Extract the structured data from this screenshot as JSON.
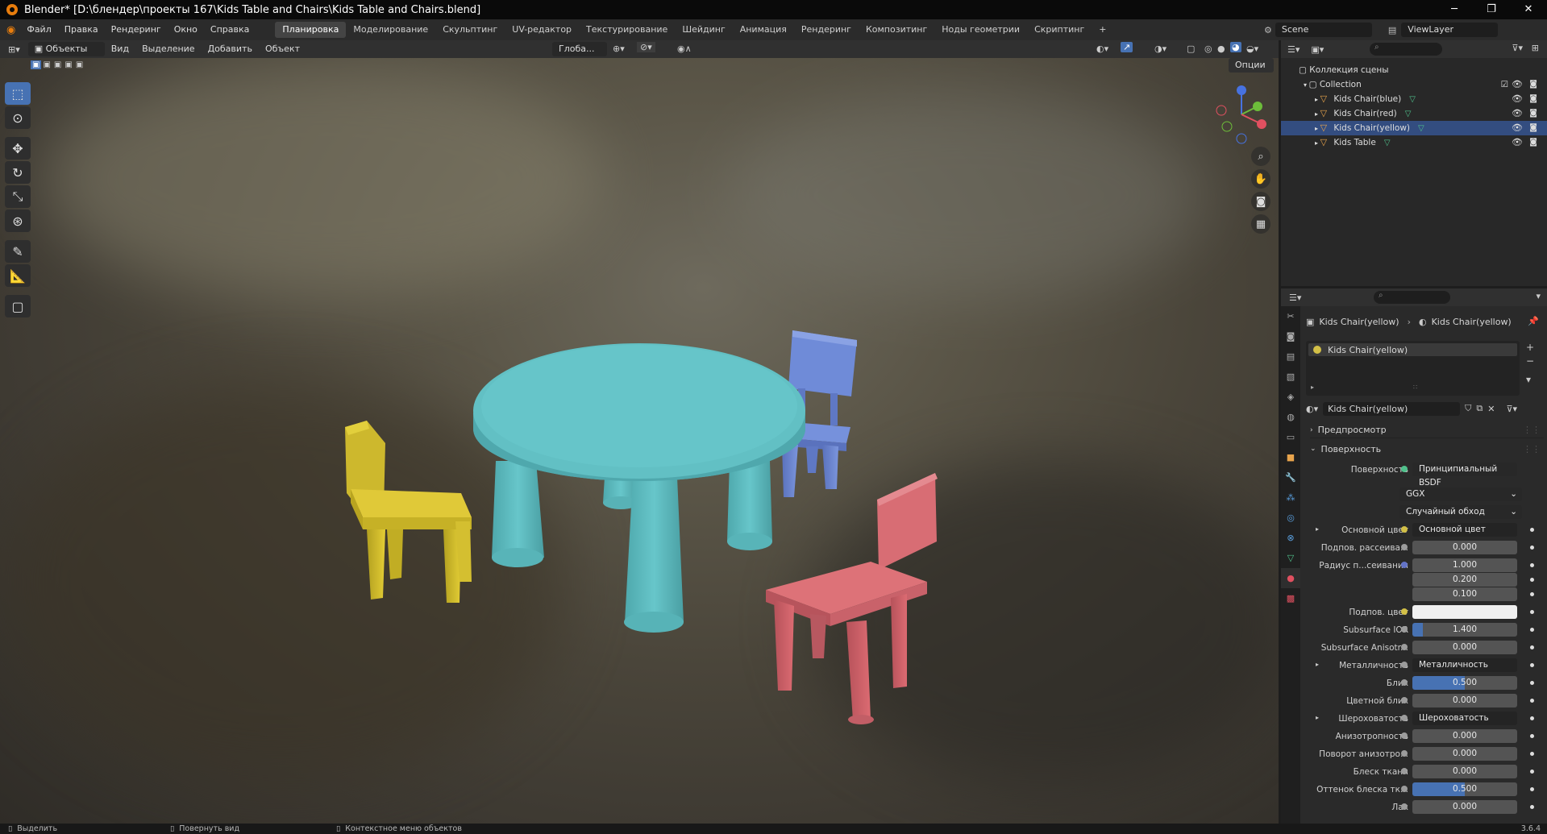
{
  "window": {
    "title": "Blender* [D:\\блендер\\проекты 167\\Kids Table and Chairs\\Kids Table and Chairs.blend]",
    "minimize": "─",
    "maximize": "❐",
    "close": "✕"
  },
  "menu": {
    "items": [
      "Файл",
      "Правка",
      "Рендеринг",
      "Окно",
      "Справка"
    ],
    "workspaces": [
      "Планировка",
      "Моделирование",
      "Скульптинг",
      "UV-редактор",
      "Текстурирование",
      "Шейдинг",
      "Анимация",
      "Рендеринг",
      "Композитинг",
      "Ноды геометрии",
      "Скриптинг"
    ],
    "add_tab": "+",
    "scene": "Scene",
    "view_layer": "ViewLayer"
  },
  "viewport_header": {
    "mode": "Объекты",
    "menus": [
      "Вид",
      "Выделение",
      "Добавить",
      "Объект"
    ],
    "orientation": "Глоба...",
    "options": "Опции"
  },
  "outliner": {
    "root": "Коллекция сцены",
    "collection": "Collection",
    "objects": [
      "Kids Chair(blue)",
      "Kids Chair(red)",
      "Kids Chair(yellow)",
      "Kids Table"
    ],
    "selected_index": 2
  },
  "properties": {
    "breadcrumb_object": "Kids Chair(yellow)",
    "breadcrumb_material": "Kids Chair(yellow)",
    "slot": "Kids Chair(yellow)",
    "material_name": "Kids Chair(yellow)",
    "panel_preview": "Предпросмотр",
    "panel_surface": "Поверхность",
    "surface_label": "Поверхность",
    "surface_value": "Принципиальный BSDF",
    "distribution": "GGX",
    "subsurface_method": "Случайный обход",
    "rows": [
      {
        "label": "Основной цвет",
        "value": "Основной цвет",
        "type": "link",
        "dot": "y",
        "expand": true
      },
      {
        "label": "Подпов. рассеива...",
        "value": "0.000",
        "type": "num",
        "dot": "g"
      },
      {
        "label": "Радиус п...сеивания",
        "value": "1.000",
        "type": "num",
        "dot": "b"
      },
      {
        "label": "",
        "value": "0.200",
        "type": "num",
        "dot": ""
      },
      {
        "label": "",
        "value": "0.100",
        "type": "num",
        "dot": ""
      },
      {
        "label": "Подпов. цвет",
        "value": "",
        "type": "color",
        "dot": "y"
      },
      {
        "label": "Subsurface IOR",
        "value": "1.400",
        "type": "fill",
        "fill": 0.1,
        "dot": "g"
      },
      {
        "label": "Subsurface Anisotr...",
        "value": "0.000",
        "type": "num",
        "dot": "g"
      },
      {
        "label": "Металличность",
        "value": "Металличность",
        "type": "link",
        "dot": "g",
        "expand": true
      },
      {
        "label": "Блик",
        "value": "0.500",
        "type": "fill",
        "fill": 0.5,
        "dot": "g"
      },
      {
        "label": "Цветной блик",
        "value": "0.000",
        "type": "num",
        "dot": "g"
      },
      {
        "label": "Шероховатость",
        "value": "Шероховатость",
        "type": "link",
        "dot": "g",
        "expand": true
      },
      {
        "label": "Анизотропность",
        "value": "0.000",
        "type": "num",
        "dot": "g"
      },
      {
        "label": "Поворот анизотро...",
        "value": "0.000",
        "type": "num",
        "dot": "g"
      },
      {
        "label": "Блеск ткани",
        "value": "0.000",
        "type": "num",
        "dot": "g"
      },
      {
        "label": "Оттенок блеска тк...",
        "value": "0.500",
        "type": "fill",
        "fill": 0.5,
        "dot": "g"
      },
      {
        "label": "Лак",
        "value": "0.000",
        "type": "num",
        "dot": "g"
      }
    ]
  },
  "statusbar": {
    "select": "Выделить",
    "rotate": "Повернуть вид",
    "context": "Контекстное меню объектов",
    "version": "3.6.4"
  },
  "colors": {
    "accent": "#4772b3",
    "table": "#5bbcc0",
    "chair_yellow": "#d8c430",
    "chair_blue": "#6a86d4",
    "chair_red": "#d06068"
  }
}
